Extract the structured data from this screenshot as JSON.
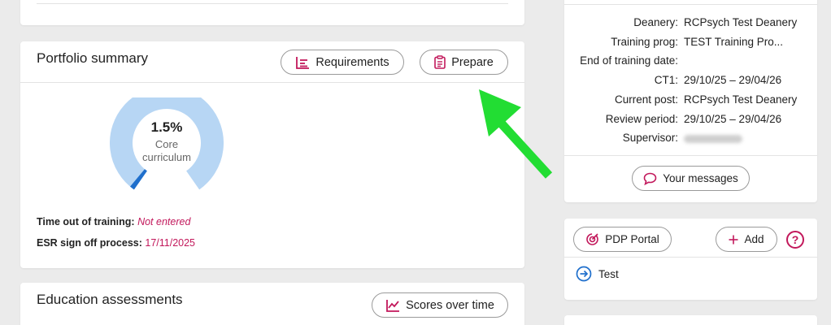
{
  "portfolio": {
    "title": "Portfolio summary",
    "requirements_label": "Requirements",
    "prepare_label": "Prepare",
    "gauge": {
      "percent_text": "1.5%",
      "label_line1": "Core",
      "label_line2": "curriculum",
      "progress_fraction": 0.015,
      "track_color": "#b7d6f4",
      "fill_color": "#1f6fcc"
    },
    "time_out_label": "Time out of training:",
    "time_out_value": "Not entered",
    "esr_label": "ESR sign off process:",
    "esr_value": "17/11/2025"
  },
  "education": {
    "title": "Education assessments",
    "scores_label": "Scores over time"
  },
  "trainee": {
    "rows": [
      {
        "key": "Deanery:",
        "value": "RCPsych Test Deanery"
      },
      {
        "key": "Training prog:",
        "value": "TEST Training Pro..."
      },
      {
        "key": "End of training date:",
        "value": ""
      },
      {
        "key": "CT1:",
        "value": "29/10/25 – 29/04/26"
      },
      {
        "key": "Current post:",
        "value": "RCPsych Test Deanery"
      },
      {
        "key": "Review period:",
        "value": "29/10/25 – 29/04/26"
      },
      {
        "key": "Supervisor:",
        "value": ""
      }
    ],
    "messages_label": "Your messages"
  },
  "pdp": {
    "portal_label": "PDP Portal",
    "add_label": "Add",
    "help_glyph": "?",
    "items": [
      "Test"
    ]
  },
  "colors": {
    "accent": "#c2185b",
    "blue": "#1f6fcc",
    "arrow": "#22dd33"
  }
}
